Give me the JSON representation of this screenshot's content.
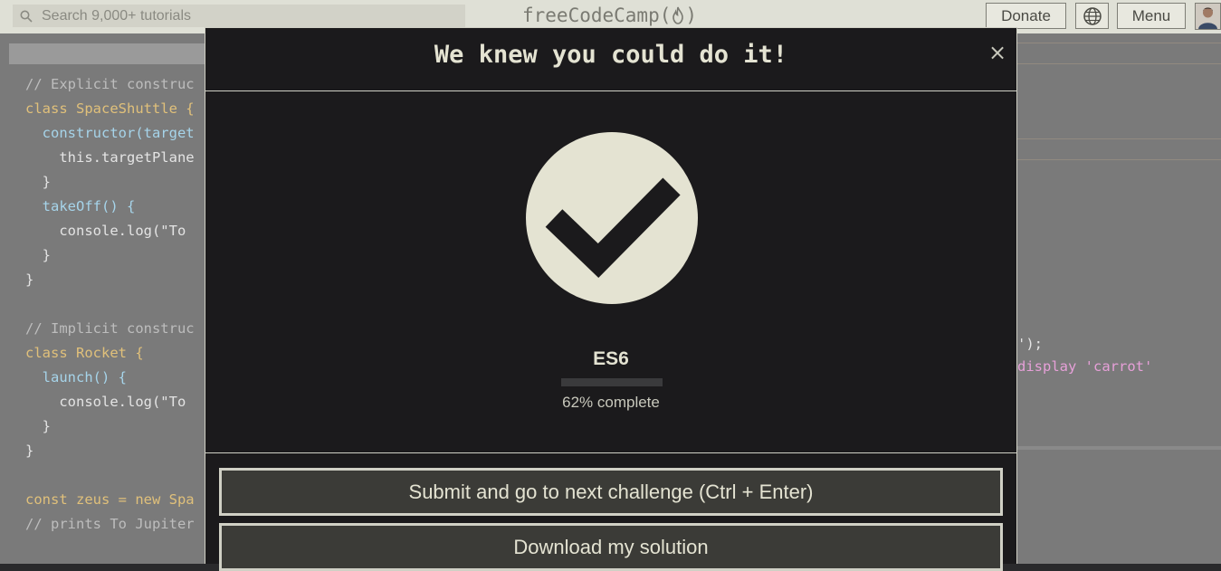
{
  "navbar": {
    "search_placeholder": "Search 9,000+ tutorials",
    "brand_text": "freeCodeCamp",
    "brand_paren_open": "(",
    "brand_paren_close": ")",
    "donate_label": "Donate",
    "menu_label": "Menu"
  },
  "editor": {
    "code_lines": [
      "// Explicit construc",
      "class SpaceShuttle {",
      "  constructor(target",
      "    this.targetPlane",
      "  }",
      "  takeOff() {",
      "    console.log(\"To ",
      "  }",
      "}",
      "",
      "// Implicit construc",
      "class Rocket {",
      "  launch() {",
      "    console.log(\"To ",
      "  }",
      "}",
      "",
      "const zeus = new Spa",
      "// prints To Jupiter"
    ],
    "right_fragment_1": "');",
    "right_fragment_2": "display 'carrot'"
  },
  "modal": {
    "title": "We knew you could do it!",
    "close_symbol": "×",
    "block_name": "ES6",
    "progress_percent": 62,
    "progress_text": "62% complete",
    "submit_label": "Submit and go to next challenge (Ctrl + Enter)",
    "download_label": "Download my solution"
  },
  "colors": {
    "modal_background": "#1b1a1c",
    "modal_text": "#e4e3d2",
    "button_background": "#3b3b37",
    "check_circle": "#e4e3d2",
    "navbar_background": "#dfe0d6"
  },
  "icons": {
    "search": "search-icon",
    "flame": "flame-icon",
    "globe": "globe-icon",
    "avatar": "avatar",
    "checkmark": "checkmark-icon",
    "close": "close-icon"
  }
}
